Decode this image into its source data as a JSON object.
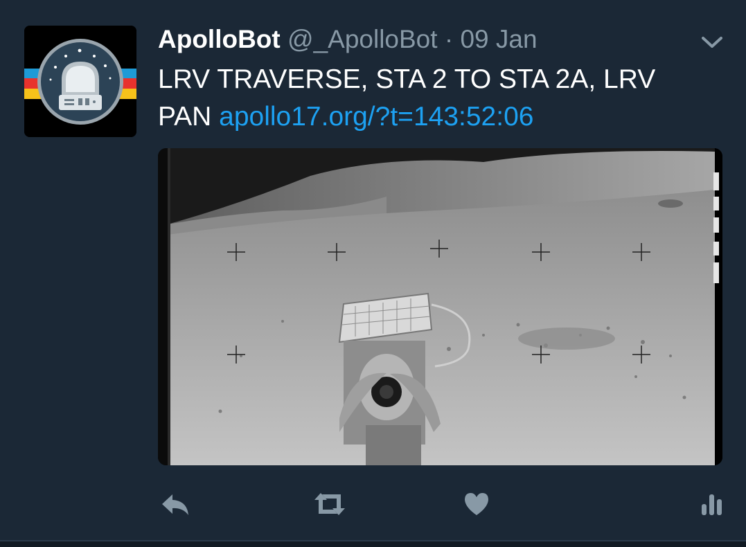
{
  "tweet": {
    "display_name": "ApolloBot",
    "handle": "@_ApolloBot",
    "separator": "·",
    "timestamp": "09 Jan",
    "text": "LRV TRAVERSE, STA 2 TO STA 2A, LRV PAN",
    "link": "apollo17.org/?t=143:52:06"
  },
  "colors": {
    "background": "#1b2836",
    "link": "#1da1f2",
    "muted": "#8899a6",
    "action_icon": "#8899a6"
  },
  "icons": {
    "caret": "chevron-down-icon",
    "reply": "reply-icon",
    "retweet": "retweet-icon",
    "like": "heart-icon",
    "analytics": "analytics-icon"
  }
}
